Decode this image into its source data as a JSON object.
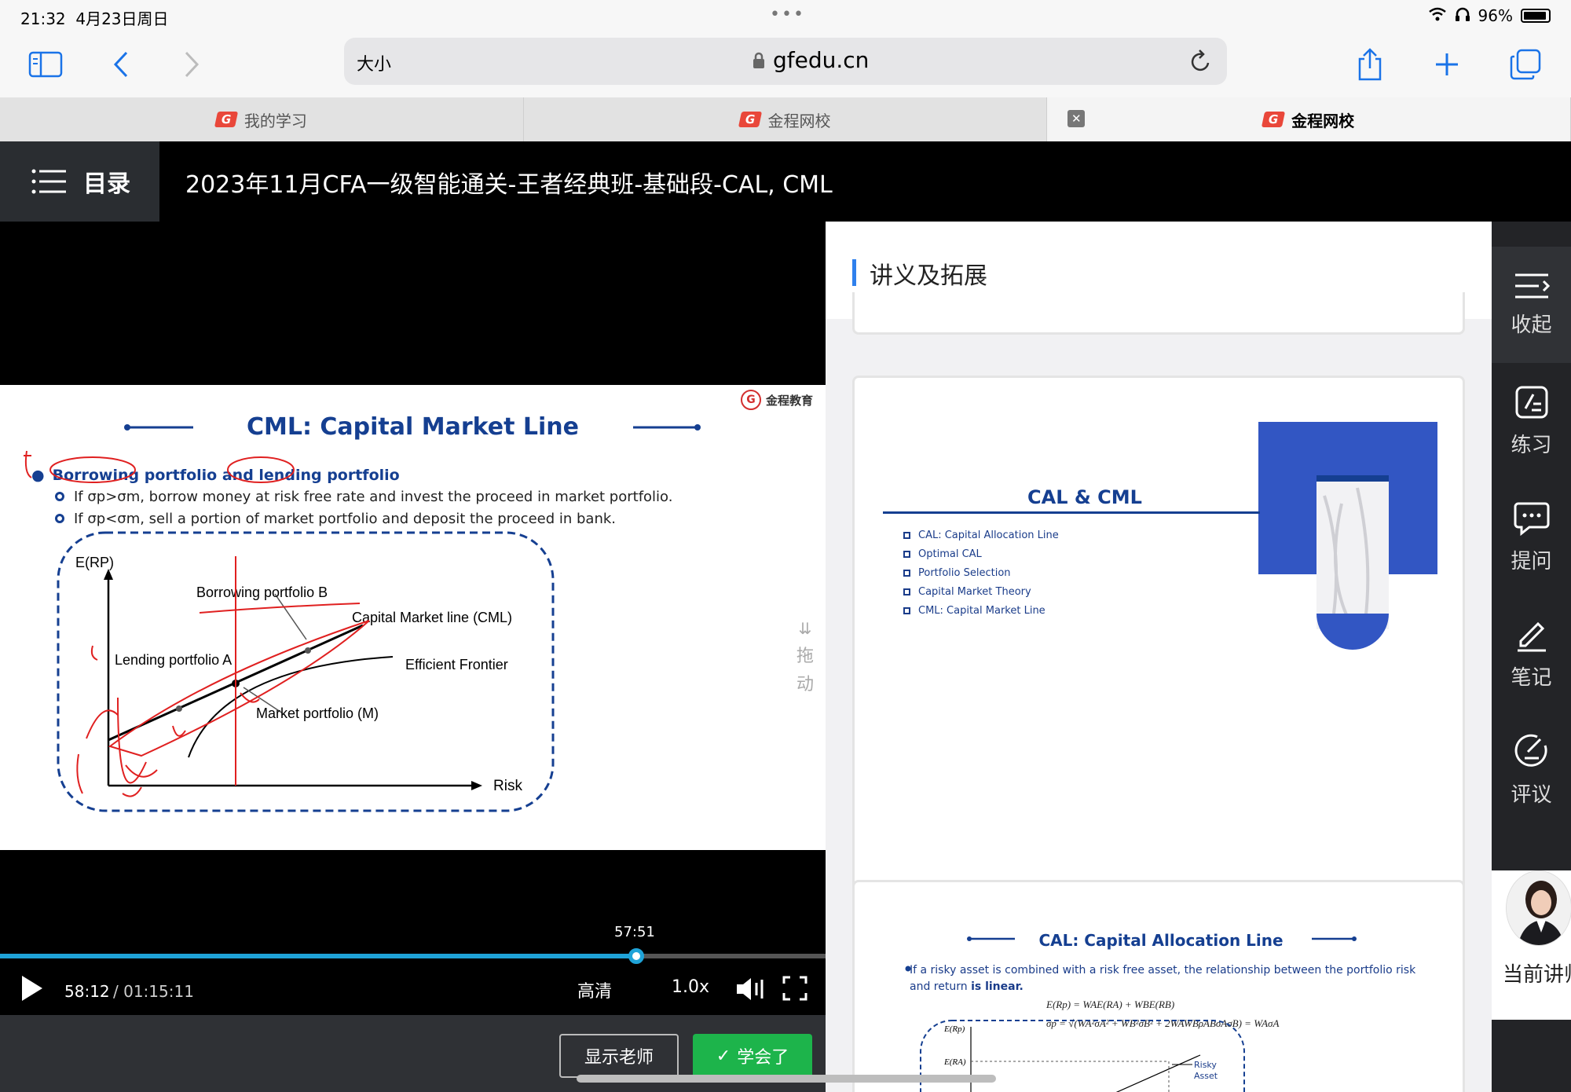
{
  "status": {
    "time": "21:32",
    "date": "4月23日周日",
    "battery": "96%"
  },
  "browser": {
    "size_label": "大小",
    "url": "gfedu.cn",
    "tabs": [
      {
        "label": "我的学习"
      },
      {
        "label": "金程网校"
      },
      {
        "label": "金程网校"
      }
    ]
  },
  "header": {
    "menu_label": "目录",
    "course_title": "2023年11月CFA一级智能通关-王者经典班-基础段-CAL, CML"
  },
  "slide": {
    "brand": "金程教育",
    "title": "CML: Capital Market Line",
    "bullet_main": "Borrowing portfolio and lending portfolio",
    "bullet_sub1": "If σp>σm, borrow money at risk free rate and invest the proceed in market portfolio.",
    "bullet_sub2": "If σp<σm, sell a portion of market portfolio and deposit the proceed in bank.",
    "chart_labels": {
      "y_axis": "E(RP)",
      "x_axis": "Risk",
      "borrowing": "Borrowing portfolio B",
      "cml": "Capital Market line (CML)",
      "lending": "Lending  portfolio A",
      "frontier": "Efficient Frontier",
      "market": "Market portfolio (M)"
    }
  },
  "drag_label": "拖动",
  "player": {
    "seek_time": "57:51",
    "progress": 0.771,
    "current_time": "58:12",
    "total_time": "/ 01:15:11",
    "quality": "高清",
    "speed": "1.0x",
    "show_teacher": "显示老师",
    "learned": "学会了"
  },
  "panel": {
    "title": "讲义及拓展",
    "card1": {
      "title": "CAL & CML",
      "items": [
        "CAL: Capital Allocation Line",
        "Optimal CAL",
        "Portfolio Selection",
        "Capital Market Theory",
        "CML: Capital Market Line"
      ]
    },
    "card2": {
      "title": "CAL: Capital Allocation Line",
      "text_a": "If a risky asset is combined with a risk free asset, the relationship between the portfolio risk and return",
      "text_b": "is linear.",
      "formula1": "E(Rp) = WAE(RA) + WBE(RB)",
      "formula2": "σp = √(WA²σA² + WB²σB² + 2WAWBρABσAσB) = WAσA",
      "chart_labels": {
        "y_top": "E(Rp)",
        "y_mid": "E(RA)",
        "risky": "Risky",
        "asset": "Asset"
      }
    }
  },
  "rail": [
    {
      "label": "收起"
    },
    {
      "label": "练习"
    },
    {
      "label": "提问"
    },
    {
      "label": "笔记"
    },
    {
      "label": "评议"
    }
  ],
  "teacher_label": "当前讲师",
  "colors": {
    "accent": "#1fa3d8",
    "green": "#1db44b",
    "slide_blue": "#153f91",
    "ink_red": "#e02020"
  }
}
